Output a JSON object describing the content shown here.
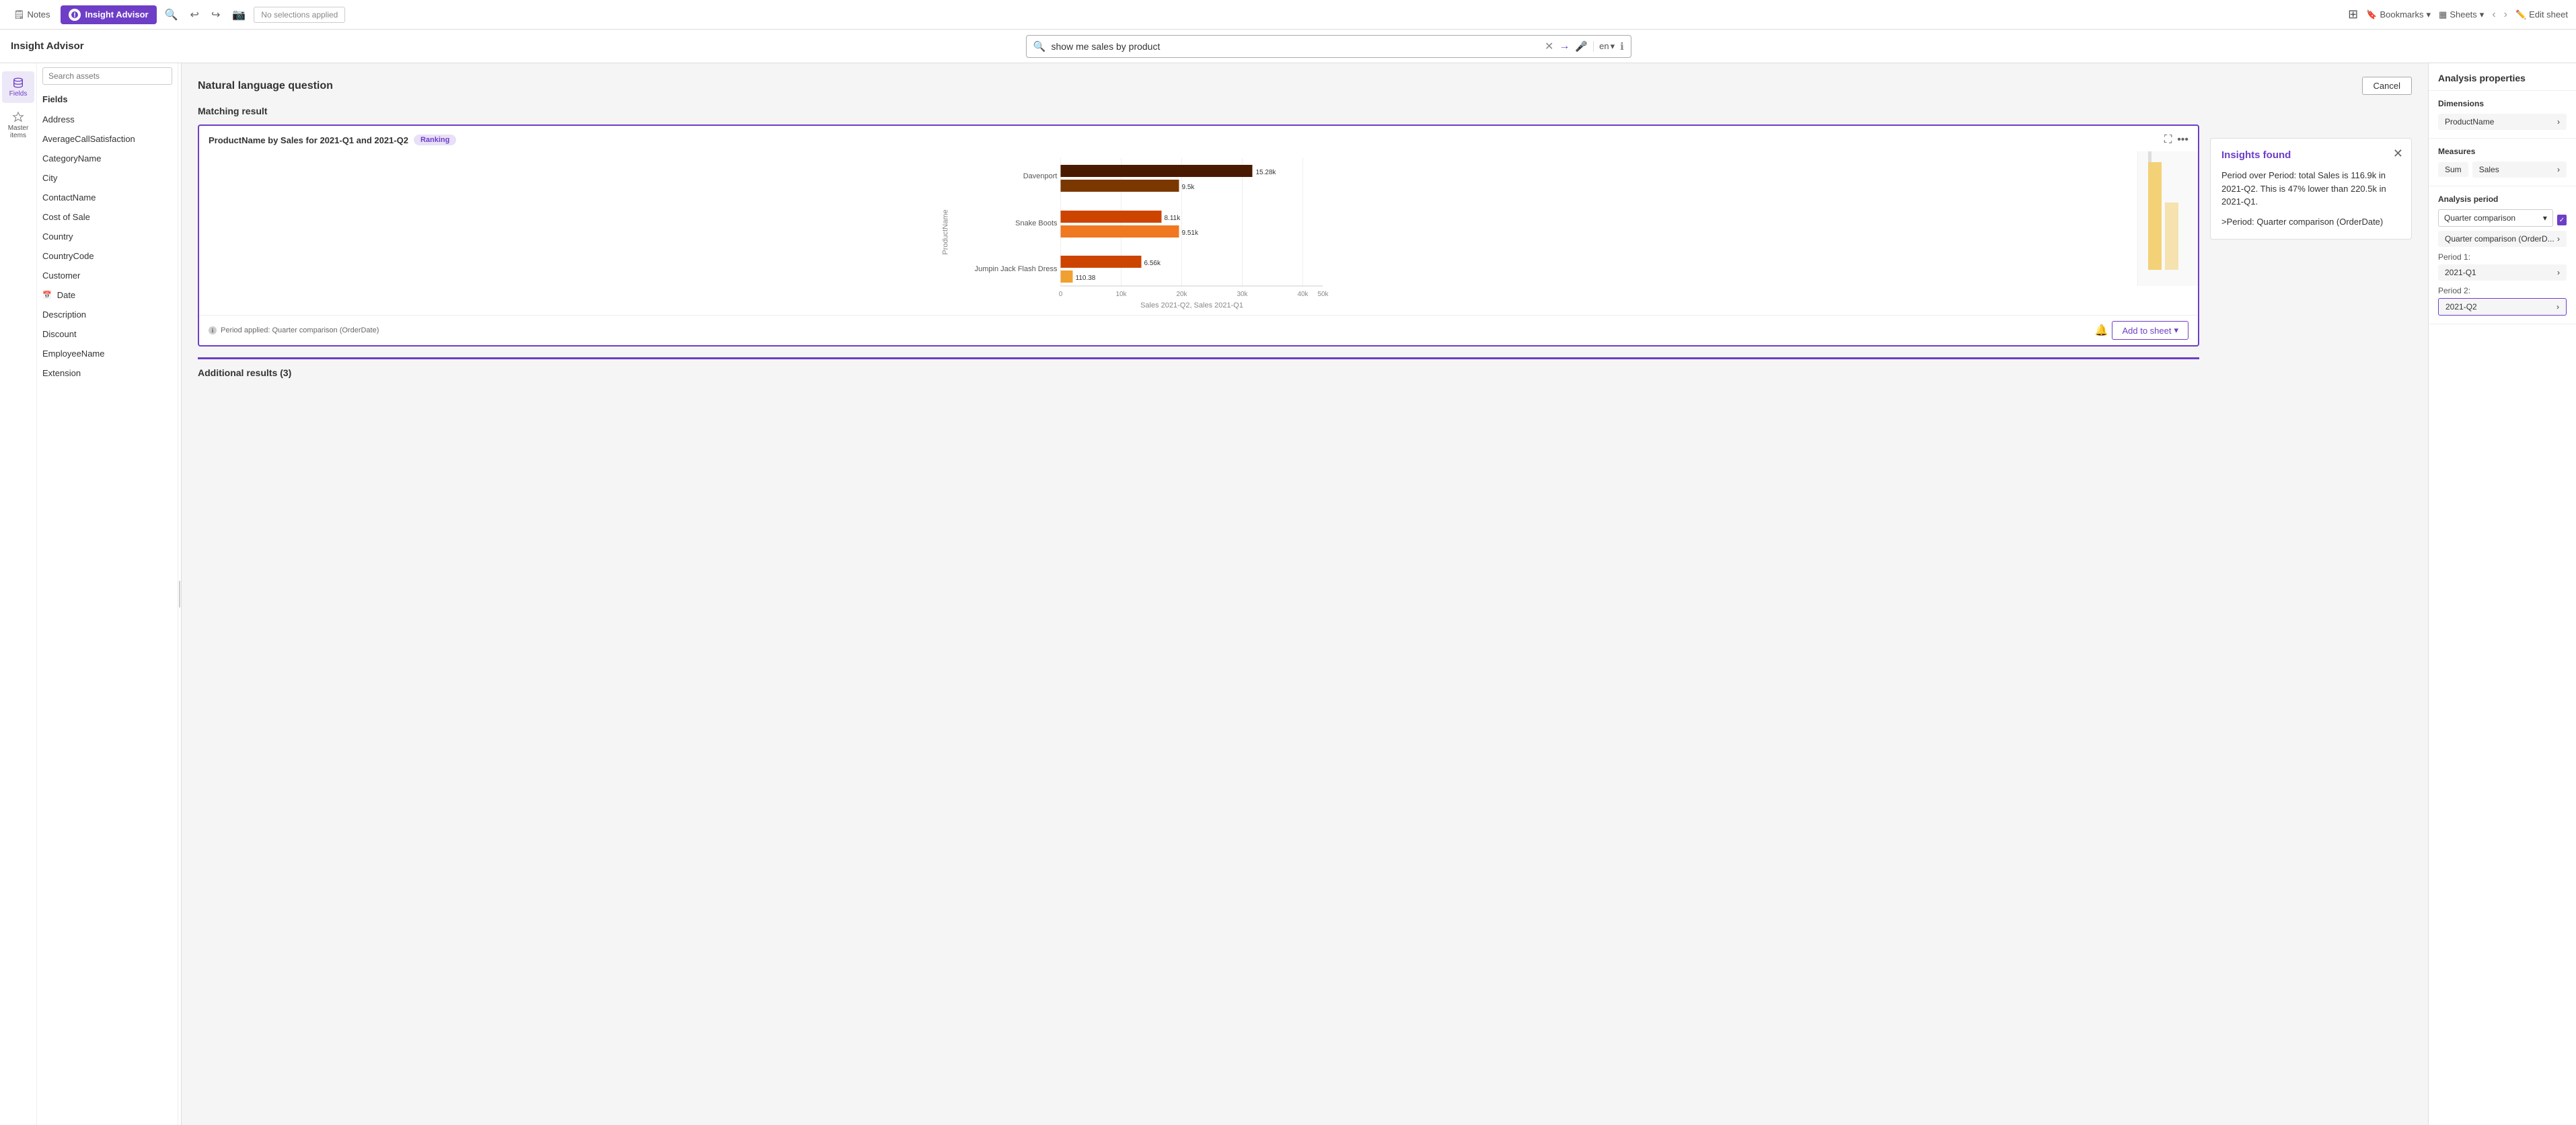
{
  "topBar": {
    "notes_label": "Notes",
    "insight_advisor_label": "Insight Advisor",
    "no_selections": "No selections applied",
    "bookmarks_label": "Bookmarks",
    "sheets_label": "Sheets",
    "edit_sheet_label": "Edit sheet"
  },
  "secondBar": {
    "title": "Insight Advisor",
    "search_value": "show me sales by product",
    "lang": "en"
  },
  "sidebar": {
    "search_placeholder": "Search assets",
    "fields_header": "Fields",
    "fields": [
      {
        "name": "Address",
        "type": "text"
      },
      {
        "name": "AverageCallSatisfaction",
        "type": "text"
      },
      {
        "name": "CategoryName",
        "type": "text"
      },
      {
        "name": "City",
        "type": "text"
      },
      {
        "name": "ContactName",
        "type": "text"
      },
      {
        "name": "Cost of Sale",
        "type": "text"
      },
      {
        "name": "Country",
        "type": "text"
      },
      {
        "name": "CountryCode",
        "type": "text"
      },
      {
        "name": "Customer",
        "type": "text"
      },
      {
        "name": "Date",
        "type": "date"
      },
      {
        "name": "Description",
        "type": "text"
      },
      {
        "name": "Discount",
        "type": "text"
      },
      {
        "name": "EmployeeName",
        "type": "text"
      },
      {
        "name": "Extension",
        "type": "text"
      }
    ],
    "icons": [
      {
        "id": "fields",
        "label": "Fields",
        "active": true
      },
      {
        "id": "master-items",
        "label": "Master items",
        "active": false
      }
    ]
  },
  "content": {
    "natural_lang_title": "Natural language question",
    "cancel_label": "Cancel",
    "matching_result": "Matching result",
    "chart": {
      "title": "ProductName by Sales for 2021-Q1 and 2021-Q2",
      "badge": "Ranking",
      "bars": [
        {
          "label": "Davenport",
          "bar1_width": 290,
          "bar1_val": "15.28k",
          "bar1_color": "dark-brown",
          "bar2_width": 180,
          "bar2_val": "9.5k",
          "bar2_color": "medium-brown"
        },
        {
          "label": "Snake Boots",
          "bar1_width": 155,
          "bar1_val": "8.11k",
          "bar1_color": "orange",
          "bar2_width": 182,
          "bar2_val": "9.51k",
          "bar2_color": "light-orange"
        },
        {
          "label": "Jumpin Jack Flash Dress",
          "bar1_width": 125,
          "bar1_val": "6.56k",
          "bar1_color": "orange",
          "bar2_width": 20,
          "bar2_val": "110.38",
          "bar2_color": "light-orange"
        }
      ],
      "x_axis": [
        "0",
        "10k",
        "20k",
        "30k",
        "40k",
        "50k"
      ],
      "x_axis_label": "Sales 2021-Q2, Sales 2021-Q1",
      "y_axis_label": "ProductName",
      "period_info": "Period applied:  Quarter comparison (OrderDate)",
      "add_to_sheet": "Add to sheet"
    },
    "additional_results": "Additional results (3)"
  },
  "insights": {
    "title": "Insights found",
    "body": "Period over Period: total Sales is 116.9k in 2021-Q2. This is 47% lower than 220.5k in 2021-Q1.",
    "link": ">Period: Quarter comparison (OrderDate)"
  },
  "rightPanel": {
    "title": "Analysis properties",
    "dimensions_title": "Dimensions",
    "dimension_tag": "ProductName",
    "measures_title": "Measures",
    "measure_tag1": "Sum",
    "measure_tag2": "Sales",
    "analysis_period_title": "Analysis period",
    "analysis_period_select": "Quarter comparison",
    "analysis_period_sub": "Quarter comparison (OrderD...",
    "period1_label": "Period 1:",
    "period1_value": "2021-Q1",
    "period2_label": "Period 2:",
    "period2_value": "2021-Q2"
  }
}
